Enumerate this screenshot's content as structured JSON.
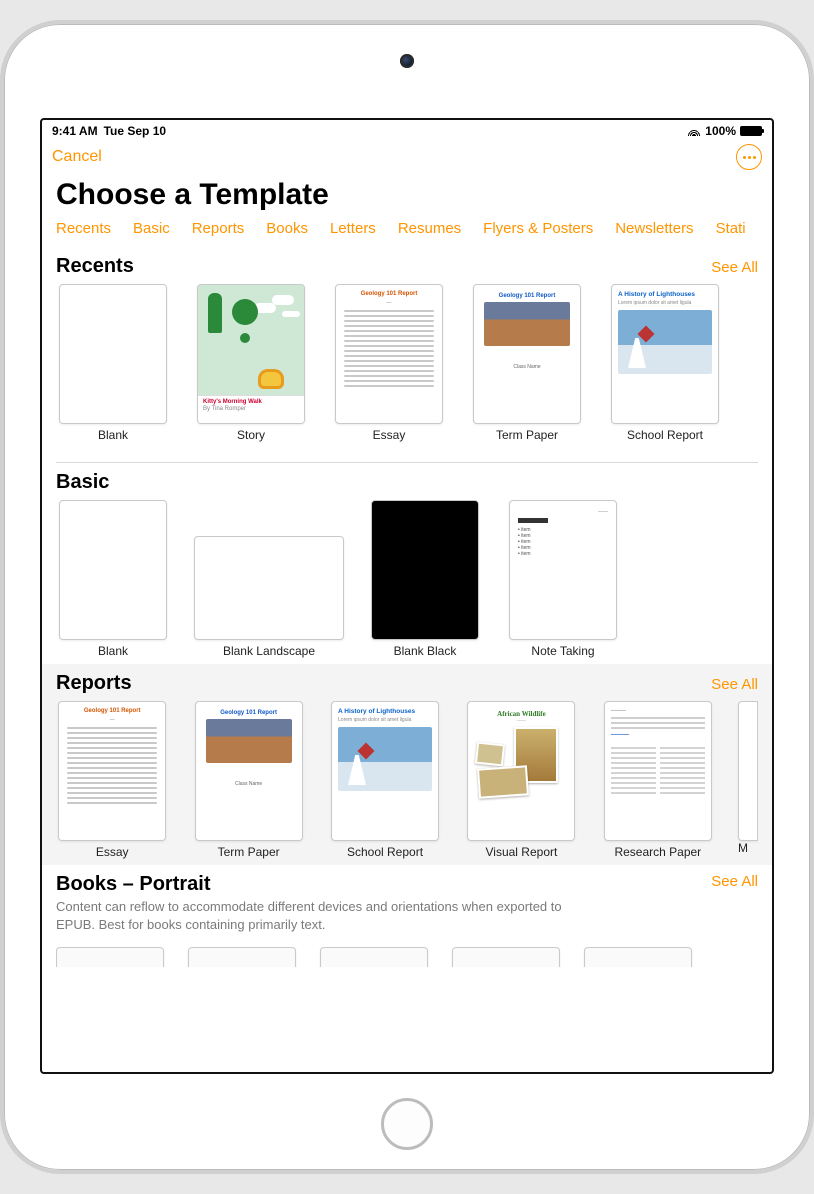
{
  "status": {
    "time": "9:41 AM",
    "date": "Tue Sep 10",
    "battery_pct": "100%"
  },
  "nav": {
    "cancel": "Cancel"
  },
  "page": {
    "title": "Choose a Template"
  },
  "categories": [
    "Recents",
    "Basic",
    "Reports",
    "Books",
    "Letters",
    "Resumes",
    "Flyers & Posters",
    "Newsletters",
    "Stati"
  ],
  "sections": {
    "recents": {
      "title": "Recents",
      "see_all": "See All",
      "items": [
        "Blank",
        "Story",
        "Essay",
        "Term Paper",
        "School Report"
      ],
      "story_caption_title": "Kitty's Morning Walk",
      "story_caption_sub": "By Tina Romper",
      "essay_title": "Geology 101 Report",
      "term_title": "Geology 101 Report",
      "term_author": "Class Name",
      "school_title": "A History of Lighthouses",
      "school_sub": "Lorem ipsum dolor sit amet ligula"
    },
    "basic": {
      "title": "Basic",
      "items": [
        "Blank",
        "Blank Landscape",
        "Blank Black",
        "Note Taking"
      ]
    },
    "reports": {
      "title": "Reports",
      "see_all": "See All",
      "items": [
        "Essay",
        "Term Paper",
        "School Report",
        "Visual Report",
        "Research Paper"
      ],
      "visual_title": "African Wildlife",
      "partial_label": "M"
    },
    "books": {
      "title": "Books – Portrait",
      "see_all": "See All",
      "subtitle": "Content can reflow to accommodate different devices and orientations when exported to EPUB. Best for books containing primarily text."
    }
  }
}
